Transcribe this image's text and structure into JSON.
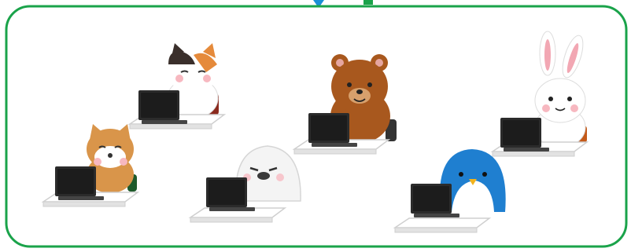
{
  "illustration": {
    "frame_color": "#1aa34a",
    "connector_color": "#1a8fd6",
    "characters": [
      {
        "animal": "shiba-dog",
        "fur": "#d9954a",
        "device": "laptop"
      },
      {
        "animal": "calico-cat",
        "fur": "#ffffff",
        "device": "laptop"
      },
      {
        "animal": "seal",
        "fur": "#f4f4f4",
        "device": "laptop"
      },
      {
        "animal": "brown-bear",
        "fur": "#a8581e",
        "device": "laptop"
      },
      {
        "animal": "penguin",
        "fur": "#1f7fd0",
        "device": "laptop"
      },
      {
        "animal": "rabbit",
        "fur": "#ffffff",
        "device": "laptop"
      }
    ]
  }
}
